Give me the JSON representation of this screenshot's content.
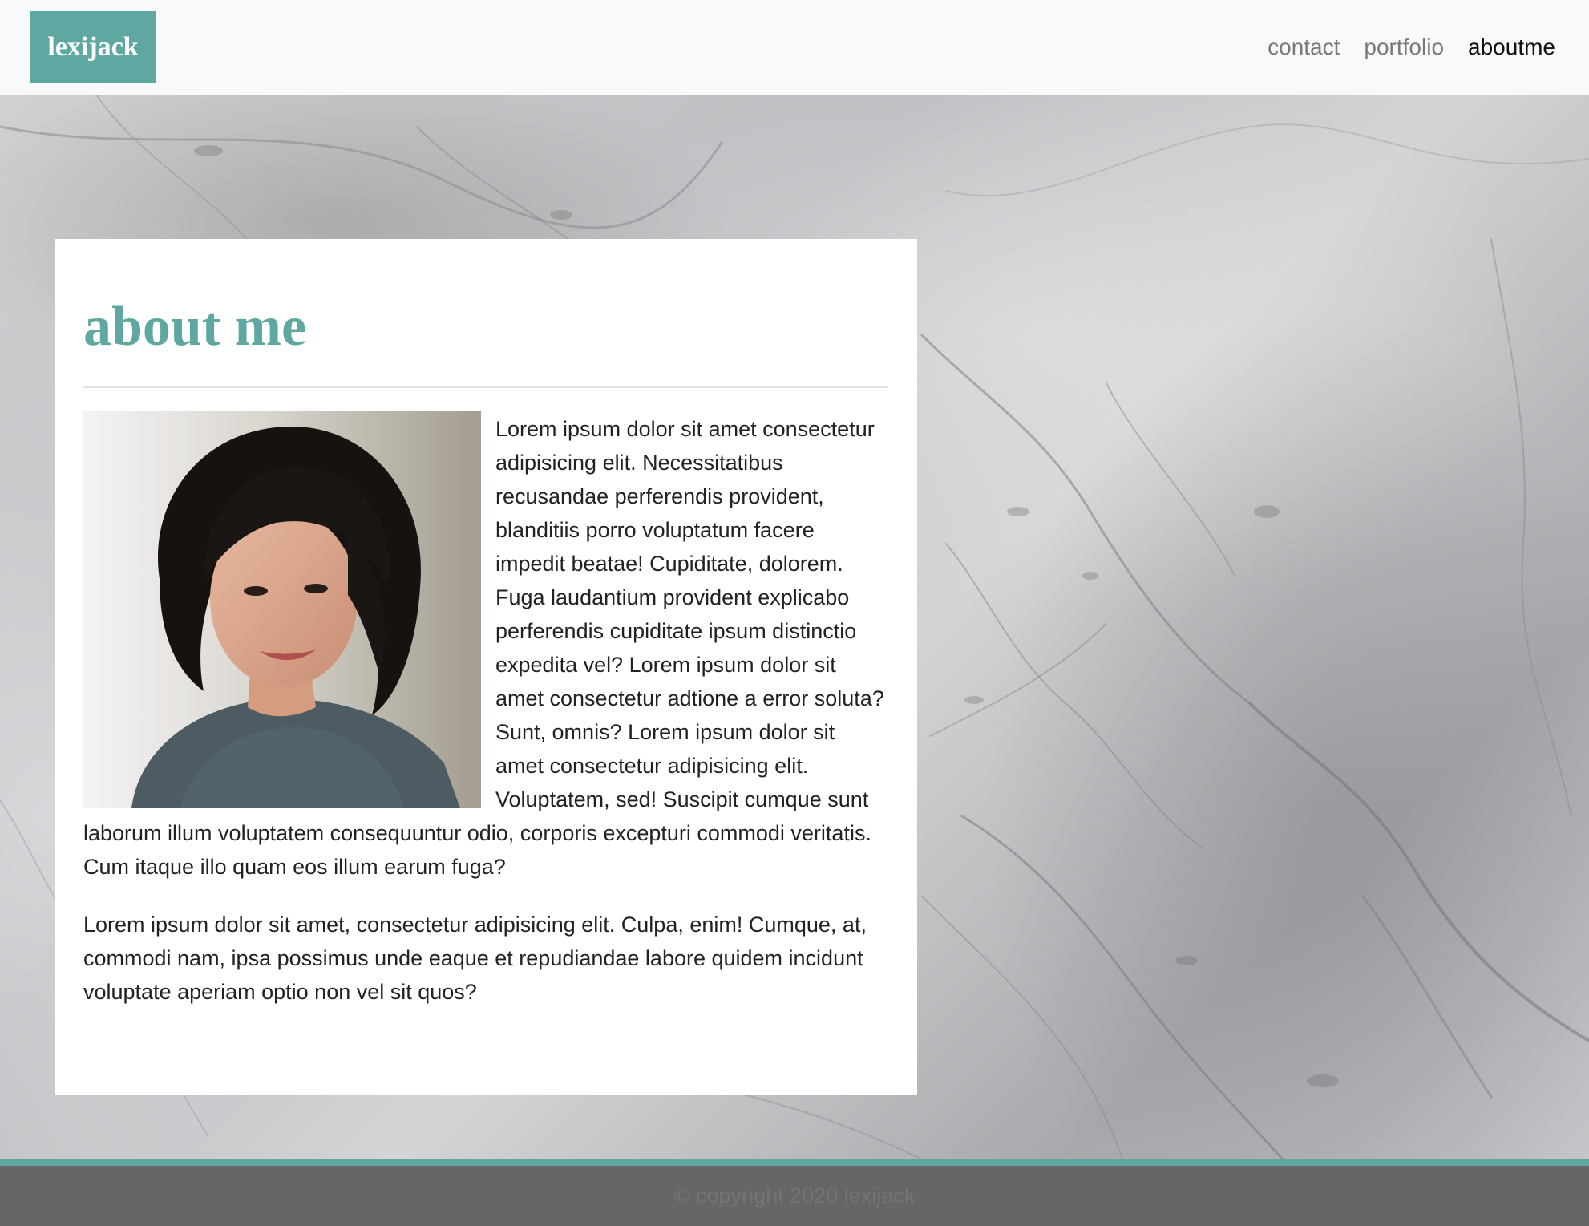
{
  "brand": "lexijack",
  "nav": {
    "items": [
      "contact",
      "portfolio",
      "aboutme"
    ],
    "active": "aboutme"
  },
  "about": {
    "title": "about me",
    "paragraph1": "Lorem ipsum dolor sit amet consectetur adipisicing elit. Necessitatibus recusandae perferendis provident, blanditiis porro voluptatum facere impedit beatae! Cupiditate, dolorem. Fuga laudantium provident explicabo perferendis cupiditate ipsum distinctio expedita vel? Lorem ipsum dolor sit amet consectetur adtione a error soluta? Sunt, omnis? Lorem ipsum dolor sit amet consectetur adipisicing elit. Voluptatem, sed! Suscipit cumque sunt laborum illum voluptatem consequuntur odio, corporis excepturi commodi veritatis. Cum itaque illo quam eos illum earum fuga?",
    "paragraph2": "Lorem ipsum dolor sit amet, consectetur adipisicing elit. Culpa, enim! Cumque, at, commodi nam, ipsa possimus unde eaque et repudiandae labore quidem incidunt voluptate aperiam optio non vel sit quos?"
  },
  "footer": {
    "copyright": "© copyright 2020 lexijack"
  },
  "colors": {
    "accent": "#5fa8a1",
    "navbar_bg": "#f8f9fa",
    "footer_bg": "#666666",
    "active_link": "#111111",
    "inactive_link": "#7a7a7a"
  }
}
